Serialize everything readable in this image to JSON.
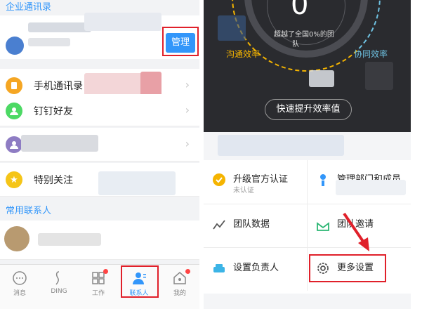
{
  "left": {
    "enterprise_header": "企业通讯录",
    "manage_label": "管理",
    "rows": [
      {
        "label": "手机通讯录",
        "icon": "phone-book-icon",
        "color": "#f5a623"
      },
      {
        "label": "钉钉好友",
        "icon": "user-icon",
        "color": "#4cd964"
      },
      {
        "label": "",
        "icon": "group-icon",
        "color": "#8e7cc3"
      },
      {
        "label": "特别关注",
        "icon": "star-icon",
        "color": "#f5c518"
      }
    ],
    "frequent_header": "常用联系人",
    "tabs": [
      {
        "label": "消息",
        "icon": "chat-bubble-icon"
      },
      {
        "label": "DING",
        "icon": "ding-icon"
      },
      {
        "label": "工作",
        "icon": "grid-apps-icon"
      },
      {
        "label": "联系人",
        "icon": "contacts-icon"
      },
      {
        "label": "我的",
        "icon": "home-profile-icon"
      }
    ],
    "colors": {
      "accent": "#3296fa",
      "highlight": "#e0202a"
    }
  },
  "right": {
    "gauge_value": "0",
    "exceed_text_1": "超越了全国0%的团",
    "exceed_text_2": "队",
    "comm_eff_label": "沟通效率",
    "coop_eff_label": "协同效率",
    "speed_button": "快速提升效率值",
    "grid": [
      {
        "title": "升级官方认证",
        "sub": "未认证",
        "icon": "certified-badge-icon"
      },
      {
        "title": "管理部门和成员",
        "sub": "",
        "icon": "department-icon"
      },
      {
        "title": "团队数据",
        "sub": "",
        "icon": "line-chart-icon"
      },
      {
        "title": "团队邀请",
        "sub": "",
        "icon": "invite-icon"
      },
      {
        "title": "设置负责人",
        "sub": "",
        "icon": "sofa-icon"
      },
      {
        "title": "更多设置",
        "sub": "",
        "icon": "gear-icon"
      }
    ]
  }
}
